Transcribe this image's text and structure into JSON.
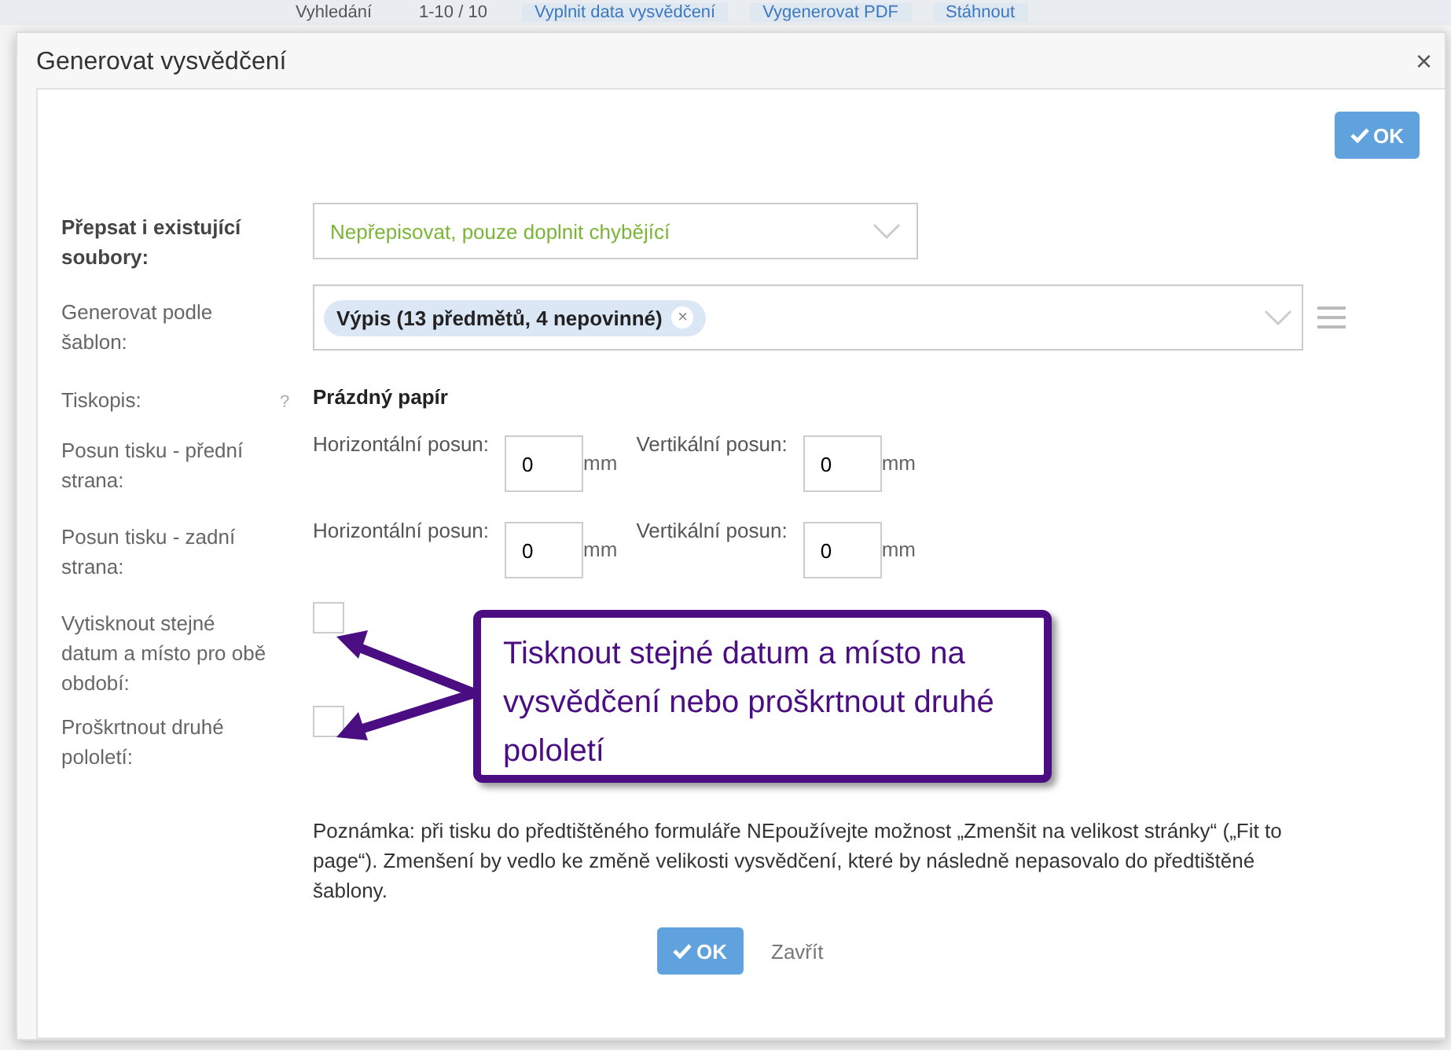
{
  "background_toolbar": {
    "items": [
      {
        "kind": "label",
        "text": "Vyhledání"
      },
      {
        "kind": "label",
        "text": "1-10 / 10"
      },
      {
        "kind": "button",
        "text": "Vyplnit data vysvědčení"
      },
      {
        "kind": "button",
        "text": "Vygenerovat PDF"
      },
      {
        "kind": "button",
        "text": "Stáhnout"
      }
    ]
  },
  "dialog": {
    "title": "Generovat vysvědčení",
    "close": "×",
    "top_button": "OK",
    "rows": [
      {
        "kind": "select",
        "label": "Přepsat i existující soubory:",
        "bold": true,
        "value": "Nepřepisovat, pouze doplnit chybějící"
      },
      {
        "kind": "tags",
        "label": "Generovat podle šablon:",
        "bold": false,
        "tags": [
          {
            "text": "Výpis (13 předmětů, 4 nepovinné)",
            "remove": "×"
          }
        ]
      },
      {
        "kind": "text",
        "label": "Tiskopis:",
        "bold": false,
        "help": "?",
        "value": "Prázdný papír"
      },
      {
        "kind": "offsets",
        "label": "Posun tisku - přední strana:",
        "bold": false,
        "fields": [
          {
            "label": "Horizontální posun:",
            "value": "0",
            "unit": "mm"
          },
          {
            "label": "Vertikální posun:",
            "value": "0",
            "unit": "mm"
          }
        ]
      },
      {
        "kind": "offsets",
        "label": "Posun tisku - zadní strana:",
        "bold": false,
        "fields": [
          {
            "label": "Horizontální posun:",
            "value": "0",
            "unit": "mm"
          },
          {
            "label": "Vertikální posun:",
            "value": "0",
            "unit": "mm"
          }
        ]
      },
      {
        "kind": "checkbox",
        "label": "Vytisknout stejné datum a místo pro obě období:",
        "bold": false,
        "checked": false
      },
      {
        "kind": "checkbox",
        "label": "Proškrtnout druhé pololetí:",
        "bold": false,
        "checked": false
      }
    ],
    "callout": "Tisknout stejné datum a místo na vysvědčení nebo proškrtnout druhé pololetí",
    "note": "Poznámka: při tisku do předtištěného formuláře NEpoužívejte možnost „Zmenšit na velikost stránky“ („Fit to page“). Zmenšení by vedlo ke změně velikosti vysvědčení, které by následně nepasovalo do předtištěné šablony.",
    "ok_button": "OK",
    "close_button": "Zavřít"
  }
}
